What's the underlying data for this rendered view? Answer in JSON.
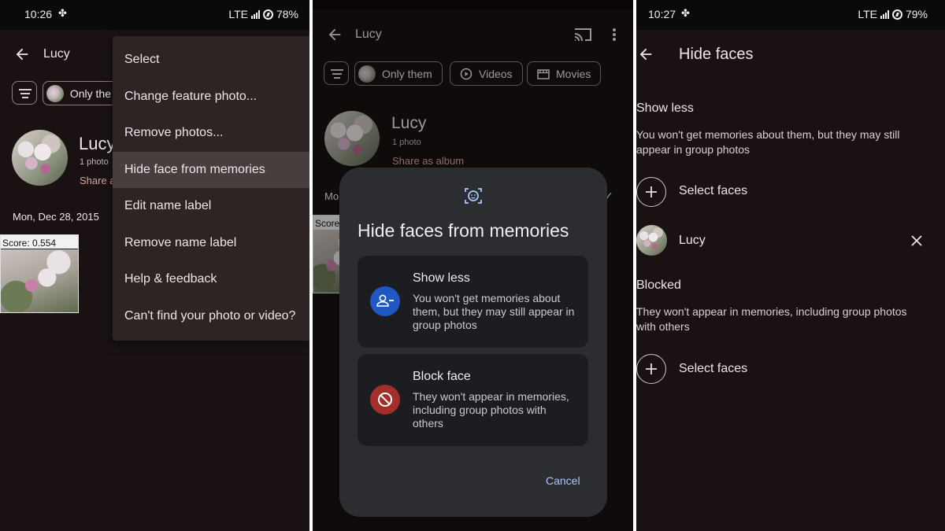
{
  "panel1": {
    "status": {
      "time": "10:26",
      "network": "LTE",
      "battery": "78%"
    },
    "header": {
      "title": "Lucy"
    },
    "chip_label": "Only the",
    "person": {
      "name": "Lucy",
      "count": "1 photo",
      "share": "Share a"
    },
    "date_label": "Mon, Dec 28, 2015",
    "score_label": "Score: 0.554",
    "menu": {
      "items": [
        "Select",
        "Change feature photo...",
        "Remove photos...",
        "Hide face from memories",
        "Edit name label",
        "Remove name label",
        "Help & feedback",
        "Can't find your photo or video?"
      ],
      "highlighted_index": 3
    }
  },
  "panel2": {
    "header": {
      "title": "Lucy"
    },
    "chips": [
      "Only them",
      "Videos",
      "Movies"
    ],
    "person": {
      "name": "Lucy",
      "count": "1 photo",
      "share": "Share as album"
    },
    "partial_label": "Mo",
    "score_partial": "Score",
    "dialog": {
      "title": "Hide faces from memories",
      "options": [
        {
          "title": "Show less",
          "desc": "You won't get memories about them, but they may still appear in group photos",
          "icon": "person-minus-icon",
          "color": "#1f57c3"
        },
        {
          "title": "Block face",
          "desc": "They won't appear in memories, including group photos with others",
          "icon": "block-icon",
          "color": "#a32f2a"
        }
      ],
      "cancel": "Cancel"
    }
  },
  "panel3": {
    "status": {
      "time": "10:27",
      "network": "LTE",
      "battery": "79%"
    },
    "header": {
      "title": "Hide faces"
    },
    "show_less": {
      "title": "Show less",
      "desc": "You won't get memories about them, but they may still appear in group photos",
      "select_label": "Select faces",
      "person": "Lucy"
    },
    "blocked": {
      "title": "Blocked",
      "desc": "They won't appear in memories, including group photos with others",
      "select_label": "Select faces"
    }
  },
  "colors": {
    "background": "#1a1212",
    "dialog": "#2b2d31",
    "accent_link": "#a9c7ff",
    "share_link": "#d7a7a0"
  }
}
